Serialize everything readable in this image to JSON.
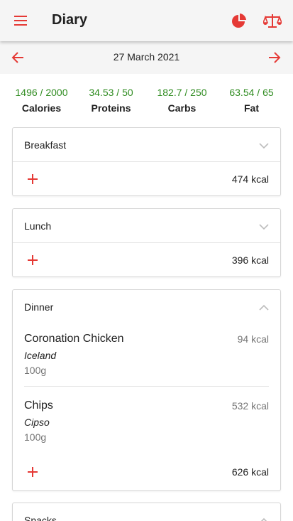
{
  "app": {
    "title": "Diary"
  },
  "date": "27 March 2021",
  "summary": [
    {
      "value": "1496 / 2000",
      "label": "Calories"
    },
    {
      "value": "34.53 / 50",
      "label": "Proteins"
    },
    {
      "value": "182.7 / 250",
      "label": "Carbs"
    },
    {
      "value": "63.54 / 65",
      "label": "Fat"
    }
  ],
  "meals": {
    "breakfast": {
      "name": "Breakfast",
      "total": "474 kcal",
      "expanded": false
    },
    "lunch": {
      "name": "Lunch",
      "total": "396 kcal",
      "expanded": false
    },
    "dinner": {
      "name": "Dinner",
      "total": "626 kcal",
      "expanded": true,
      "items": [
        {
          "name": "Coronation Chicken",
          "brand": "Iceland",
          "quantity": "100g",
          "kcal": "94 kcal"
        },
        {
          "name": "Chips",
          "brand": "Cipso",
          "quantity": "100g",
          "kcal": "532 kcal"
        }
      ]
    },
    "snacks": {
      "name": "Snacks",
      "expanded": true
    }
  },
  "colors": {
    "accent": "#e53935",
    "good": "#2e8b1f",
    "bar": "#f5f5f5"
  },
  "icons": {
    "menu": "menu-icon",
    "chart": "pie-chart-icon",
    "scale": "scale-icon",
    "prev": "arrow-left-icon",
    "next": "arrow-right-icon",
    "add": "plus-icon",
    "collapse": "chevron-up-icon",
    "expand": "chevron-down-icon"
  }
}
